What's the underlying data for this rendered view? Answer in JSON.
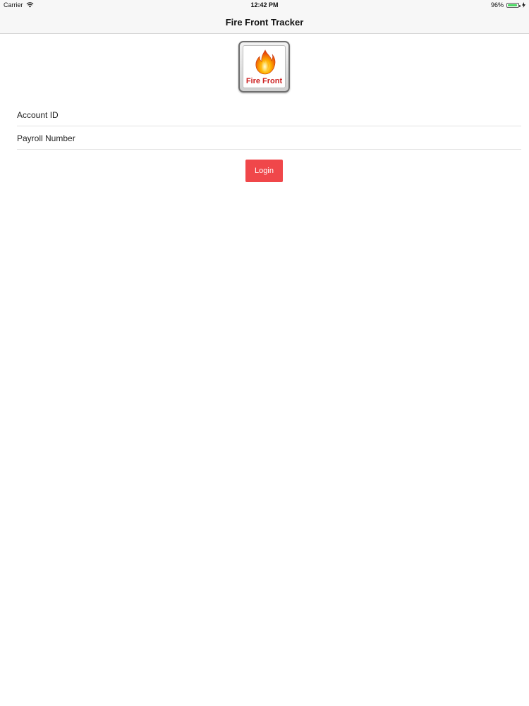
{
  "status_bar": {
    "carrier": "Carrier",
    "time": "12:42 PM",
    "battery_percent": "96%",
    "battery_level": 0.96,
    "wifi_icon": "wifi-icon",
    "charging_icon": "charging-bolt-icon"
  },
  "nav": {
    "title": "Fire Front Tracker"
  },
  "logo": {
    "text": "Fire Front",
    "icon": "flame-icon"
  },
  "form": {
    "account_id_placeholder": "Account ID",
    "account_id_value": "",
    "payroll_number_placeholder": "Payroll Number",
    "payroll_number_value": ""
  },
  "login_button": {
    "label": "Login",
    "color": "#f0474a"
  },
  "colors": {
    "battery_green": "#4cd964",
    "nav_background": "#f7f7f7",
    "logo_text": "#cc1f1f"
  }
}
